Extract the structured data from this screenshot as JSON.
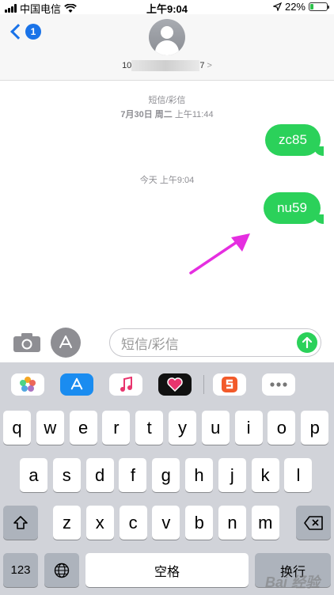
{
  "status": {
    "carrier": "中国电信",
    "time": "上午9:04",
    "battery": "22%",
    "battery_level": 0.22
  },
  "header": {
    "back_count": "1",
    "contact_prefix": "10",
    "contact_suffix": "7",
    "contact_chevron": ">"
  },
  "thread": {
    "ts1_label": "短信/彩信",
    "ts1_date": "7月30日 周二",
    "ts1_time": "上午11:44",
    "msg1": "zc85",
    "ts2": "今天 上午9:04",
    "msg2": "nu59"
  },
  "input": {
    "placeholder": "短信/彩信"
  },
  "keyboard": {
    "row1": [
      "q",
      "w",
      "e",
      "r",
      "t",
      "y",
      "u",
      "i",
      "o",
      "p"
    ],
    "row2": [
      "a",
      "s",
      "d",
      "f",
      "g",
      "h",
      "j",
      "k",
      "l"
    ],
    "row3": [
      "z",
      "x",
      "c",
      "v",
      "b",
      "n",
      "m"
    ],
    "numbers_key": "123",
    "space_key": "空格",
    "return_key": "换行"
  },
  "watermark": "Bai 经验",
  "colors": {
    "accent": "#1a73e8",
    "bubble": "#2bd15a",
    "annotation_arrow": "#e52ee0"
  }
}
